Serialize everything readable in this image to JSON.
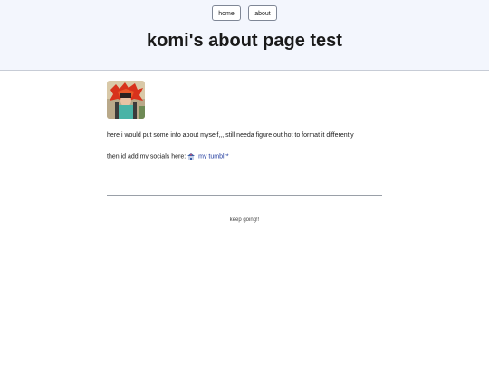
{
  "nav": {
    "home_label": "home",
    "about_label": "about"
  },
  "header": {
    "title": "komi's about page test"
  },
  "main": {
    "avatar_alt": "avatar",
    "intro": "here i would put some info about myself,,, still needa figure out hot to format it differently",
    "socials_prefix": "then id add my socials here:",
    "tumblr_label": "my tumblr*",
    "tumblr_icon": "tumblr-house-icon"
  },
  "footer": {
    "text": "keep going!!"
  },
  "colors": {
    "header_bg": "#f3f6fd",
    "link": "#1f3a9e",
    "divider": "#9aa0a8"
  }
}
